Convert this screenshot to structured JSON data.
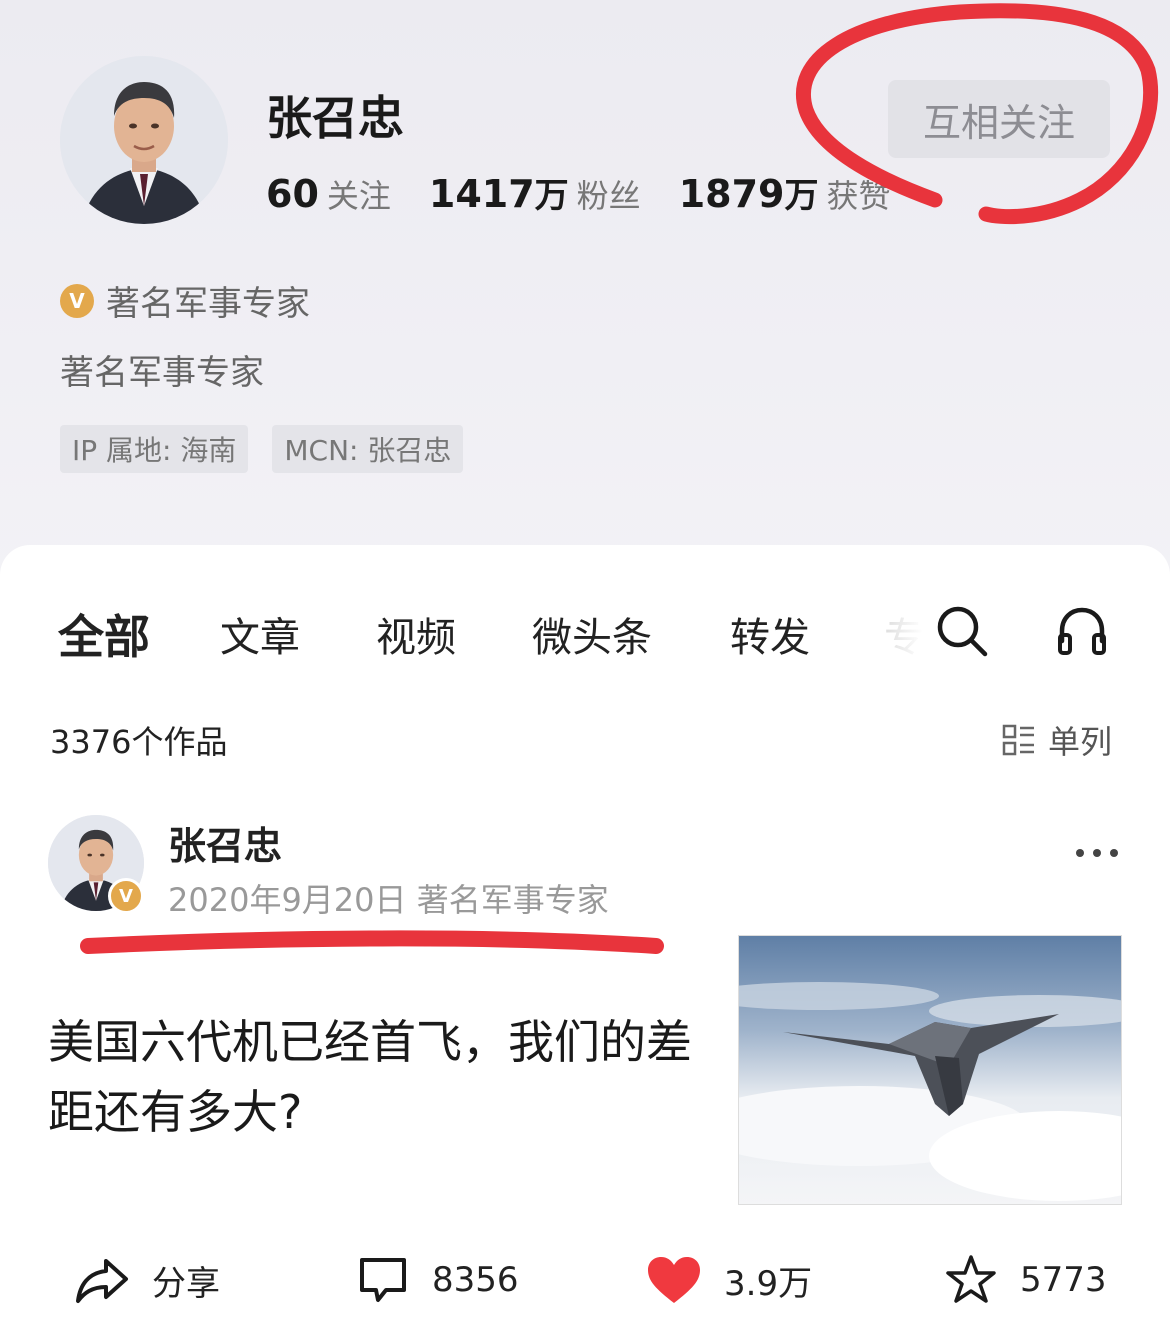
{
  "profile": {
    "name": "张召忠",
    "follow_button": "互相关注",
    "stats": [
      {
        "num": "60",
        "unit": "",
        "label": "关注"
      },
      {
        "num": "1417",
        "unit": "万",
        "label": "粉丝"
      },
      {
        "num": "1879",
        "unit": "万",
        "label": "获赞"
      }
    ],
    "verify_badge": "V",
    "verify_text": "著名军事专家",
    "bio": "著名军事专家",
    "tags": [
      "IP 属地: 海南",
      "MCN: 张召忠"
    ]
  },
  "tabs": [
    "全部",
    "文章",
    "视频",
    "微头条",
    "转发",
    "专"
  ],
  "works": {
    "count": "3376个作品",
    "layout_label": "单列"
  },
  "post": {
    "author": "张召忠",
    "badge": "V",
    "meta": "2020年9月20日   著名军事专家",
    "title": "美国六代机已经首飞，我们的差距还有多大?",
    "actions": {
      "share": "分享",
      "comments": "8356",
      "likes": "3.9万",
      "favorites": "5773"
    }
  },
  "colors": {
    "accent_red": "#e8343c",
    "verify_gold": "#e3a84c",
    "like_red": "#f0393f"
  }
}
